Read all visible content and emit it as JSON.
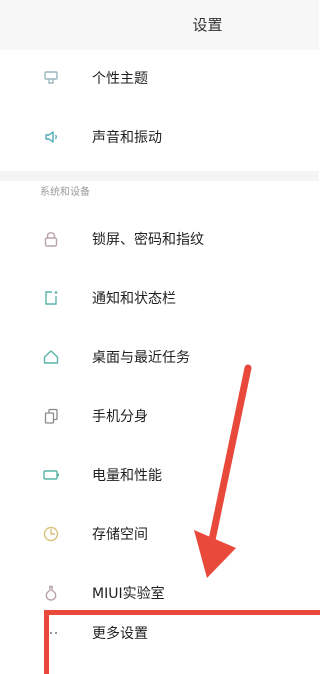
{
  "header": {
    "title": "设置"
  },
  "group1": [
    {
      "label": "个性主题",
      "icon": "theme-brush-icon"
    },
    {
      "label": "声音和振动",
      "icon": "speaker-icon"
    }
  ],
  "section": {
    "title": "系统和设备"
  },
  "group2": [
    {
      "label": "锁屏、密码和指纹",
      "icon": "lock-icon"
    },
    {
      "label": "通知和状态栏",
      "icon": "notification-icon"
    },
    {
      "label": "桌面与最近任务",
      "icon": "home-icon"
    },
    {
      "label": "手机分身",
      "icon": "dual-phone-icon"
    },
    {
      "label": "电量和性能",
      "icon": "battery-icon"
    },
    {
      "label": "存储空间",
      "icon": "storage-pie-icon"
    },
    {
      "label": "MIUI实验室",
      "icon": "lab-flask-icon"
    },
    {
      "label": "更多设置",
      "icon": "more-dots-icon"
    }
  ],
  "colors": {
    "annotation": "#e8493b",
    "icon_stroke": "#58b5a8",
    "icon_stroke_alt": "#b9a4aa"
  }
}
